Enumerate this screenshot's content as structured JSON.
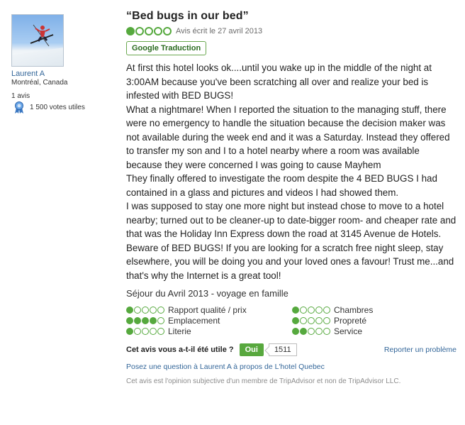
{
  "reviewer": {
    "name": "Laurent A",
    "location": "Montréal, Canada",
    "review_count": "1 avis",
    "helpful_votes": "1 500 votes utiles"
  },
  "review": {
    "title": "“Bed bugs in our bed”",
    "rating": 1,
    "rating_date": "Avis écrit le 27 avril 2013",
    "translate_label": "Google Traduction",
    "body": "At first this hotel looks ok....until you wake up in the middle of the night at 3:00AM because you've been scratching all over and realize your bed is infested with BED BUGS!\nWhat a nightmare! When I reported the situation to the managing stuff, there were no emergency to handle the situation because the decision maker was not available during the week end and it was a Saturday. Instead they offered to transfer my son and I to a hotel nearby where a room was available because they were concerned I was going to cause Mayhem\nThey finally offered to investigate the room despite the 4 BED BUGS I had contained in a glass and pictures and videos I had showed them.\nI was supposed to stay one more night but instead chose to move to a hotel nearby; turned out to be cleaner-up to date-bigger room- and cheaper rate and that was the Holiday Inn Express down the road at 3145 Avenue de Hotels.\nBeware of BED BUGS! If you are looking for a scratch free night sleep, stay elsewhere, you will be doing you and your loved ones a favour! Trust me...and that's why the Internet is a great tool!",
    "stay": "Séjour du Avril 2013 - voyage en famille",
    "subratings": [
      {
        "label": "Rapport qualité / prix",
        "rating": 1
      },
      {
        "label": "Chambres",
        "rating": 1
      },
      {
        "label": "Emplacement",
        "rating": 4
      },
      {
        "label": "Propreté",
        "rating": 1
      },
      {
        "label": "Literie",
        "rating": 1
      },
      {
        "label": "Service",
        "rating": 2
      }
    ]
  },
  "helpful": {
    "question": "Cet avis vous a-t-il été utile ?",
    "yes_label": "Oui",
    "count": "1511",
    "report_label": "Reporter un problème"
  },
  "ask_link": "Posez une question à Laurent A à propos de L'hotel Quebec",
  "disclaimer": "Cet avis est l'opinion subjective d'un membre de TripAdvisor et non de TripAdvisor LLC.",
  "colors": {
    "bubble_green": "#56a93e",
    "link_blue": "#336699",
    "button_green": "#58a83e"
  }
}
